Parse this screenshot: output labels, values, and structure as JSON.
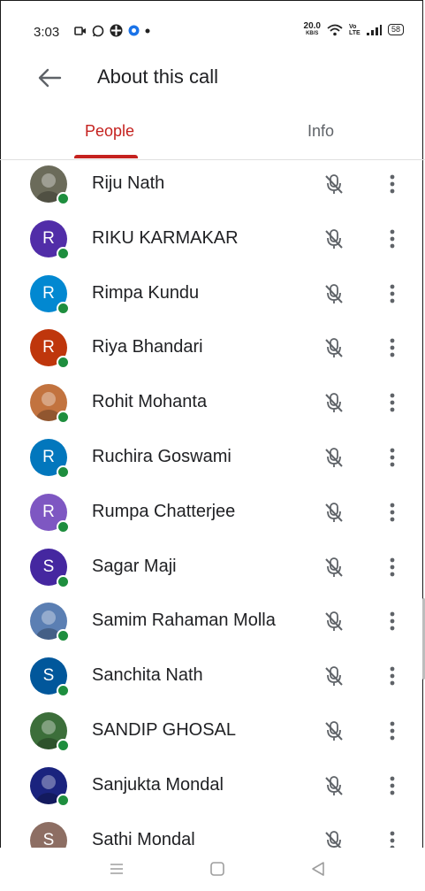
{
  "status_bar": {
    "time": "3:03",
    "speed_value": "20.0",
    "speed_unit": "KB/S",
    "volte": "Vo LTE",
    "battery": "58"
  },
  "header": {
    "title": "About this call",
    "back_icon": "arrow-back-icon"
  },
  "tabs": [
    {
      "label": "People",
      "active": true
    },
    {
      "label": "Info",
      "active": false
    }
  ],
  "colors": {
    "accent": "#c5221f",
    "online": "#1e8e3e"
  },
  "participants": [
    {
      "name": "Riju Nath",
      "initial": "",
      "avatar_color": "#6b6b5a",
      "photo": true
    },
    {
      "name": "RIKU KARMAKAR",
      "initial": "R",
      "avatar_color": "#512da8",
      "photo": false
    },
    {
      "name": "Rimpa Kundu",
      "initial": "R",
      "avatar_color": "#0288d1",
      "photo": false
    },
    {
      "name": "Riya Bhandari",
      "initial": "R",
      "avatar_color": "#bf360c",
      "photo": false
    },
    {
      "name": "Rohit Mohanta",
      "initial": "",
      "avatar_color": "#c2733f",
      "photo": true
    },
    {
      "name": "Ruchira Goswami",
      "initial": "R",
      "avatar_color": "#0277bd",
      "photo": false
    },
    {
      "name": "Rumpa Chatterjee",
      "initial": "R",
      "avatar_color": "#7e57c2",
      "photo": false
    },
    {
      "name": "Sagar Maji",
      "initial": "S",
      "avatar_color": "#4527a0",
      "photo": false
    },
    {
      "name": "Samim Rahaman Molla",
      "initial": "",
      "avatar_color": "#5b7fb3",
      "photo": true
    },
    {
      "name": "Sanchita Nath",
      "initial": "S",
      "avatar_color": "#01579b",
      "photo": false
    },
    {
      "name": "SANDIP GHOSAL",
      "initial": "",
      "avatar_color": "#3c6e3a",
      "photo": true
    },
    {
      "name": "Sanjukta Mondal",
      "initial": "",
      "avatar_color": "#1a237e",
      "photo": true
    },
    {
      "name": "Sathi Mondal",
      "initial": "S",
      "avatar_color": "#8d6e63",
      "photo": false
    }
  ],
  "row_icons": {
    "mic": "mic-off-icon",
    "more": "more-vert-icon"
  },
  "nav": [
    "menu-icon",
    "home-square-icon",
    "back-triangle-icon"
  ]
}
